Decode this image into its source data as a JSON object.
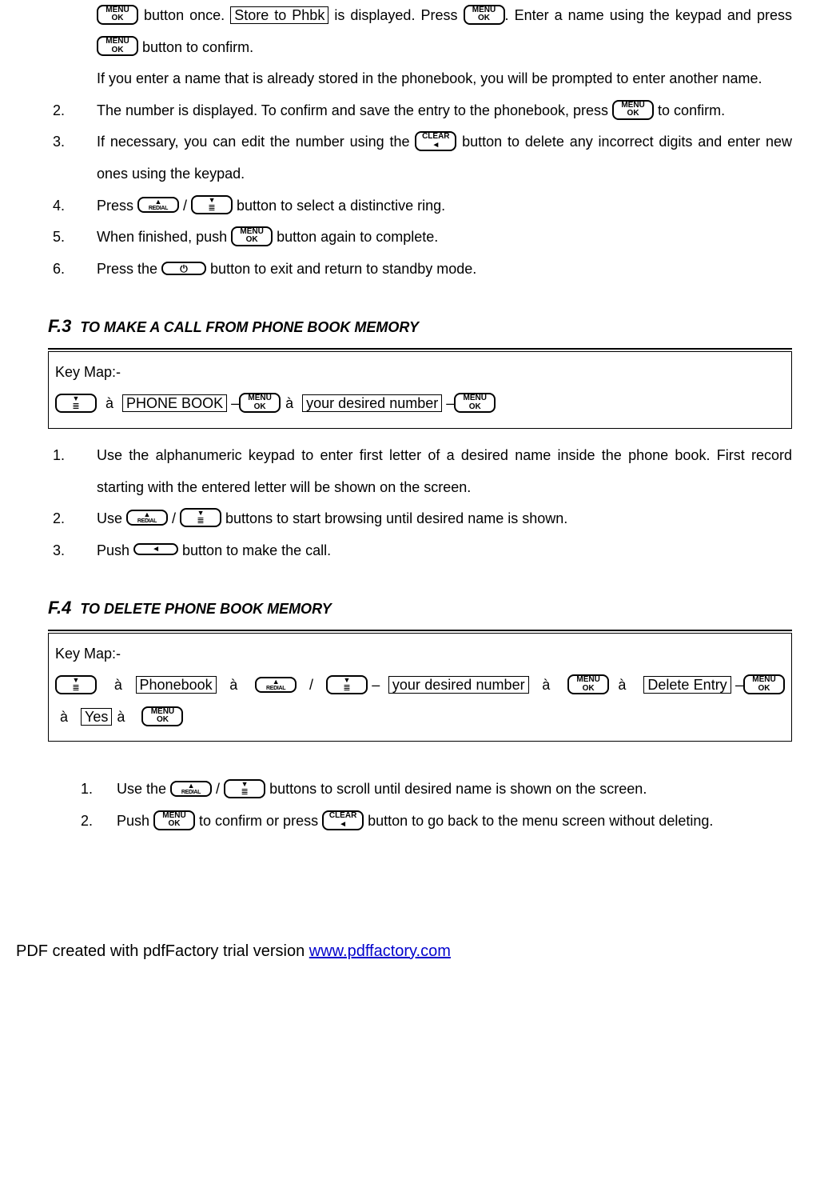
{
  "intro": {
    "p1a": " button once. ",
    "store": "Store to Phbk",
    "p1b": " is displayed. Press ",
    "p1c": ". Enter a name using the keypad and press ",
    "p1d": " button to confirm.",
    "p2": "If you enter a name that is already stored in the phonebook, you will be prompted to enter another name."
  },
  "list1": {
    "i2n": "2.",
    "i2a": "The number is displayed. To confirm and save the entry to the phonebook, press ",
    "i2b": " to confirm.",
    "i3n": "3.",
    "i3a": "If necessary, you can edit the number using the ",
    "i3b": " button to delete any incorrect digits and enter new ones using the keypad.",
    "i4n": "4.",
    "i4a": "Press ",
    "i4b": " / ",
    "i4c": " button to select a distinctive ring.",
    "i5n": "5.",
    "i5a": "When finished, push ",
    "i5b": " button again to complete.",
    "i6n": "6.",
    "i6a": "Press the ",
    "i6b": " button to exit and return to standby mode."
  },
  "f3": {
    "num": "F.3",
    "title": "TO MAKE A CALL FROM PHONE BOOK MEMORY",
    "keymap_label": "Key Map:-",
    "pb": "PHONE BOOK",
    "ydn": "your desired number",
    "i1n": "1.",
    "i1": "Use the alphanumeric keypad to enter first letter of a desired name inside the phone book. First record starting with the entered letter will be shown on the screen.",
    "i2n": "2.",
    "i2a": "Use ",
    "i2b": " / ",
    "i2c": "  buttons to start browsing until desired name is shown.",
    "i3n": "3.",
    "i3a": "Push ",
    "i3b": " button to make the call."
  },
  "f4": {
    "num": "F.4",
    "title": "TO DELETE PHONE BOOK MEMORY",
    "keymap_label": "Key Map:-",
    "pb": "Phonebook",
    "ydn": "your   desired   number",
    "de": "Delete Entry",
    "yes": "Yes",
    "i1n": "1.",
    "i1a": "Use the ",
    "i1b": " / ",
    "i1c": " buttons to scroll until desired name is shown on the screen.",
    "i2n": "2.",
    "i2a": "Push ",
    "i2b": " to confirm or press ",
    "i2c": " button to go back to the menu screen without deleting."
  },
  "keys": {
    "menu1": "MENU",
    "menu2": "OK",
    "clear1": "CLEAR",
    "redial": "REDIAL"
  },
  "arrow": "à",
  "dash": "–",
  "footer": {
    "text": "PDF created with pdfFactory trial version ",
    "link": "www.pdffactory.com"
  }
}
